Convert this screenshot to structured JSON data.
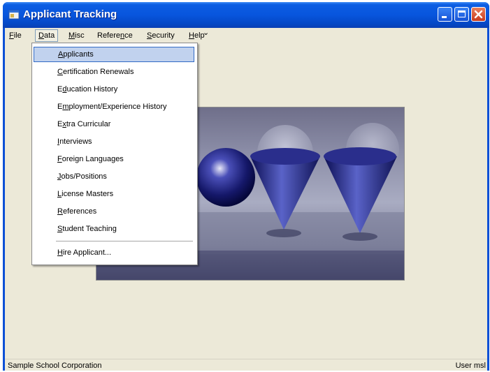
{
  "window": {
    "title": "Applicant Tracking"
  },
  "menubar": {
    "items": [
      {
        "label": "File",
        "mnemonic_index": 0
      },
      {
        "label": "Data",
        "mnemonic_index": 0
      },
      {
        "label": "Misc",
        "mnemonic_index": 0
      },
      {
        "label": "Reference",
        "mnemonic_index": 6
      },
      {
        "label": "Security",
        "mnemonic_index": 0
      },
      {
        "label": "Help",
        "mnemonic_index": 0
      }
    ],
    "overflow_glyph": "⌄"
  },
  "data_menu": {
    "items": [
      {
        "label": "Applicants",
        "mnemonic_index": 0,
        "highlighted": true
      },
      {
        "label": "Certification Renewals",
        "mnemonic_index": 0
      },
      {
        "label": "Education History",
        "mnemonic_index": 1
      },
      {
        "label": "Employment/Experience History",
        "mnemonic_index": 1
      },
      {
        "label": "Extra Curricular",
        "mnemonic_index": 1
      },
      {
        "label": "Interviews",
        "mnemonic_index": 0
      },
      {
        "label": "Foreign Languages",
        "mnemonic_index": 0
      },
      {
        "label": "Jobs/Positions",
        "mnemonic_index": 0
      },
      {
        "label": "License Masters",
        "mnemonic_index": 0
      },
      {
        "label": "References",
        "mnemonic_index": 0
      },
      {
        "label": "Student Teaching",
        "mnemonic_index": 0
      },
      {
        "label": "Hire Applicant...",
        "mnemonic_index": 0,
        "separator_before": true
      }
    ]
  },
  "statusbar": {
    "left": "Sample School Corporation",
    "right": "User msl"
  },
  "colors": {
    "titlebar": "#0855dd",
    "menu_highlight": "#c1d2ee",
    "menu_highlight_border": "#316ac5",
    "chrome": "#ece9d8"
  },
  "icons": {
    "app": "app-window-icon",
    "minimize": "minimize-icon",
    "maximize": "maximize-icon",
    "close": "close-icon"
  }
}
